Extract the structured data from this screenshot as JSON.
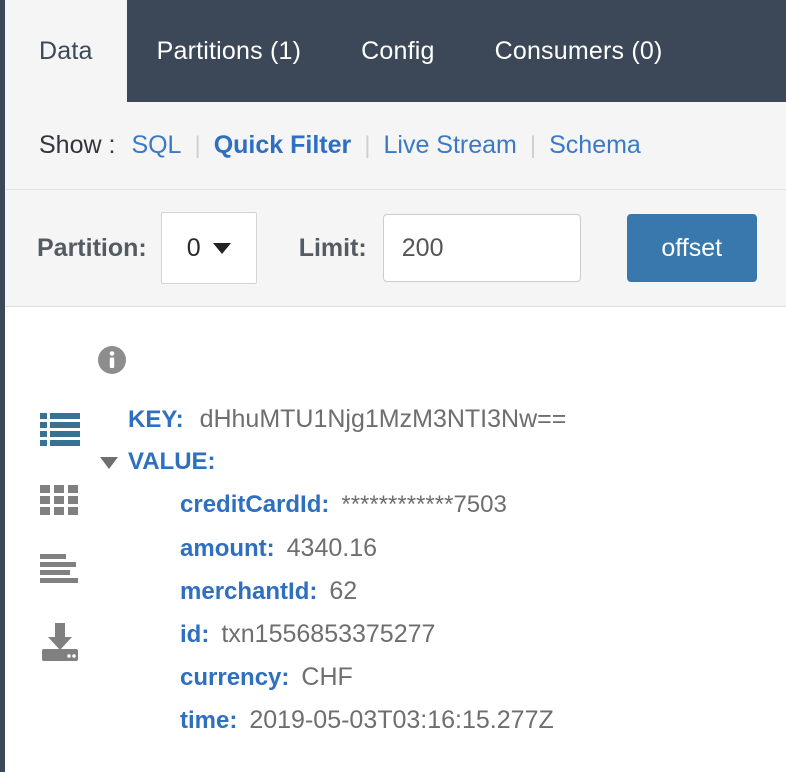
{
  "colors": {
    "tabbar_bg": "#3c4858",
    "active_tab_bg": "#f5f5f5",
    "toolbar_bg": "#f5f5f5",
    "link_blue": "#3a78c8",
    "key_blue": "#2f6fc0",
    "button_blue": "#3878ad",
    "value_gray": "#6e6e6e",
    "icon_gray": "#808080",
    "icon_active_blue": "#3a7190"
  },
  "tabs": [
    {
      "label": "Data",
      "active": true
    },
    {
      "label": "Partitions (1)",
      "active": false
    },
    {
      "label": "Config",
      "active": false
    },
    {
      "label": "Consumers (0)",
      "active": false
    }
  ],
  "show_bar": {
    "label": "Show :",
    "links": [
      {
        "label": "SQL",
        "bold": false
      },
      {
        "label": "Quick Filter",
        "bold": true
      },
      {
        "label": "Live Stream",
        "bold": false
      },
      {
        "label": "Schema",
        "bold": false
      }
    ],
    "separator": "|"
  },
  "filter_bar": {
    "partition_label": "Partition:",
    "partition_value": "0",
    "partition_options": [
      "0"
    ],
    "limit_label": "Limit:",
    "limit_value": "200",
    "limit_placeholder": "200",
    "offset_button_label": "offset"
  },
  "sidebar_icons": [
    {
      "name": "list-view-icon",
      "active": true
    },
    {
      "name": "grid-view-icon",
      "active": false
    },
    {
      "name": "text-view-icon",
      "active": false
    },
    {
      "name": "download-icon",
      "active": false
    }
  ],
  "record": {
    "info_icon": "info-icon",
    "key_label": "KEY:",
    "key_value": "dHhuMTU1Njg1MzM3NTI3Nw==",
    "value_label": "VALUE:",
    "value_expanded": true,
    "fields": [
      {
        "key": "creditCardId:",
        "value": "************7503"
      },
      {
        "key": "amount:",
        "value": "4340.16"
      },
      {
        "key": "merchantId:",
        "value": "62"
      },
      {
        "key": "id:",
        "value": "txn1556853375277"
      },
      {
        "key": "currency:",
        "value": "CHF"
      },
      {
        "key": "time:",
        "value": "2019-05-03T03:16:15.277Z"
      }
    ]
  }
}
